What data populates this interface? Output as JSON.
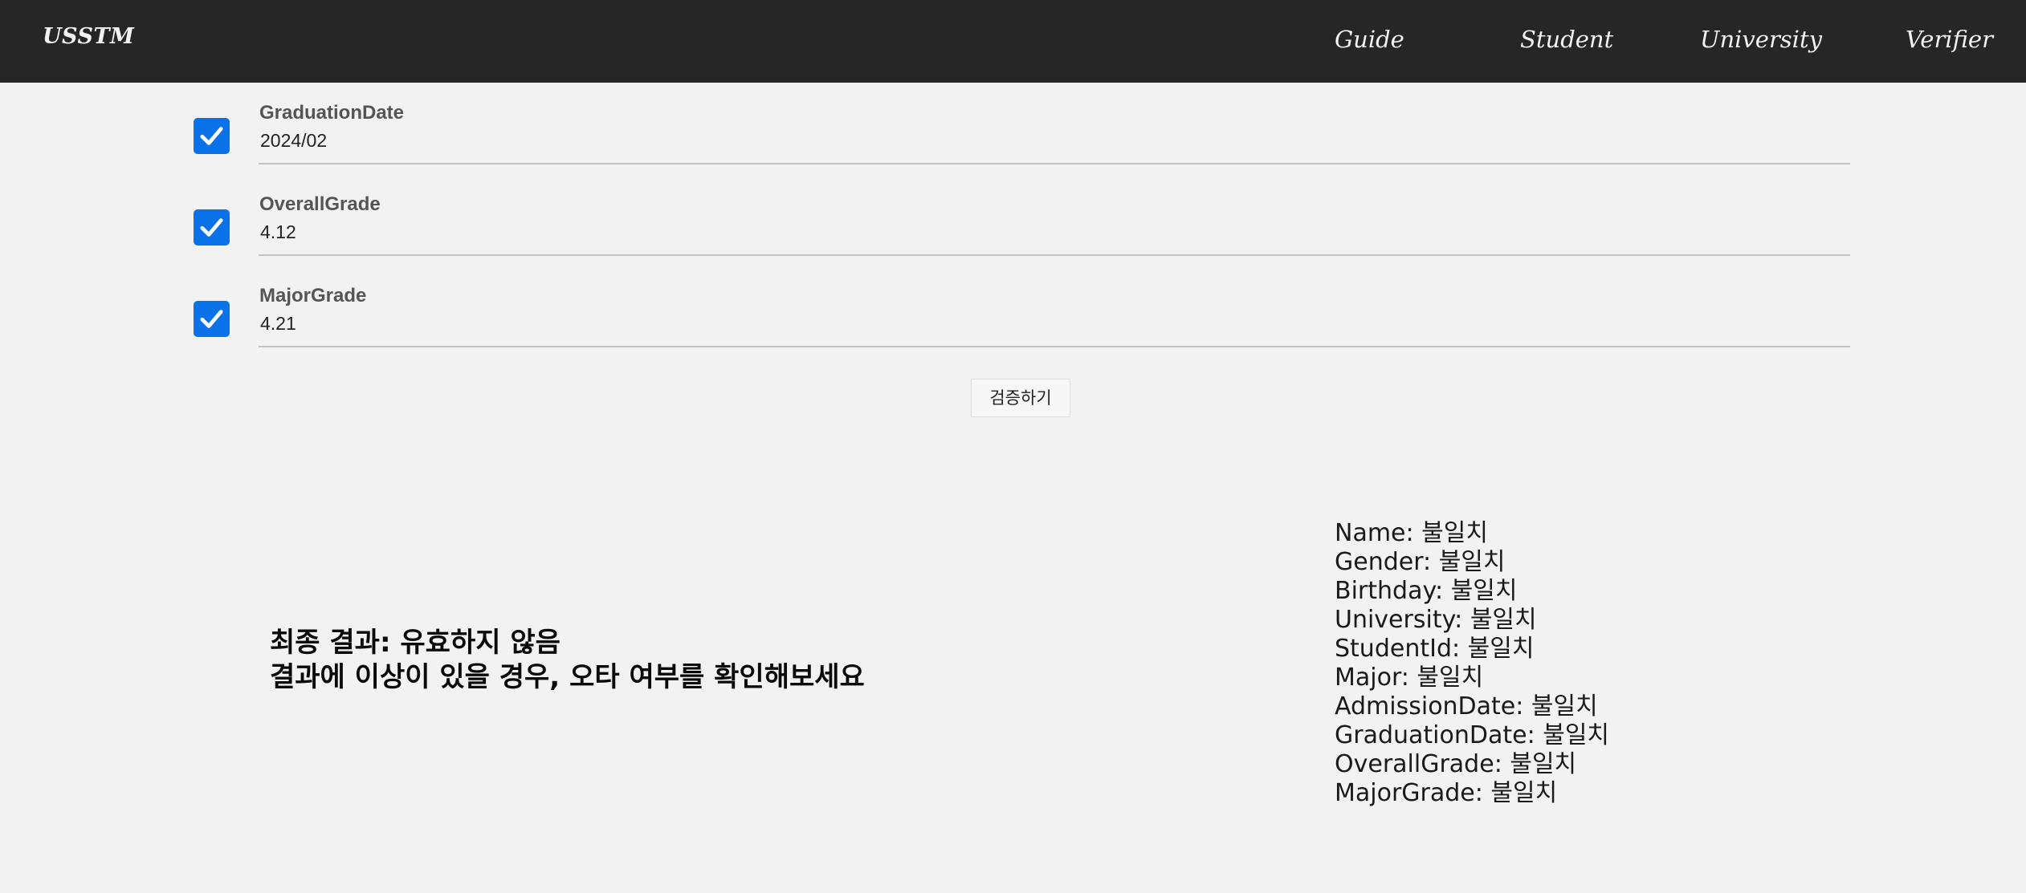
{
  "nav": {
    "brand": "USSTM",
    "links": [
      "Guide",
      "Student",
      "University",
      "Verifier"
    ]
  },
  "fields": [
    {
      "label": "GraduationDate",
      "value": "2024/02",
      "checked": true
    },
    {
      "label": "OverallGrade",
      "value": "4.12",
      "checked": true
    },
    {
      "label": "MajorGrade",
      "value": "4.21",
      "checked": true
    }
  ],
  "verify_button": "검증하기",
  "result": {
    "line1": "최종 결과: 유효하지 않음",
    "line2": "결과에 이상이 있을 경우, 오타 여부를 확인해보세요"
  },
  "field_results": [
    {
      "name": "Name",
      "status": "불일치"
    },
    {
      "name": "Gender",
      "status": "불일치"
    },
    {
      "name": "Birthday",
      "status": "불일치"
    },
    {
      "name": "University",
      "status": "불일치"
    },
    {
      "name": "StudentId",
      "status": "불일치"
    },
    {
      "name": "Major",
      "status": "불일치"
    },
    {
      "name": "AdmissionDate",
      "status": "불일치"
    },
    {
      "name": "GraduationDate",
      "status": "불일치"
    },
    {
      "name": "OverallGrade",
      "status": "불일치"
    },
    {
      "name": "MajorGrade",
      "status": "불일치"
    }
  ],
  "colors": {
    "navbar": "#262626",
    "background": "#f2f2f2",
    "checkbox": "#0a72e8"
  }
}
